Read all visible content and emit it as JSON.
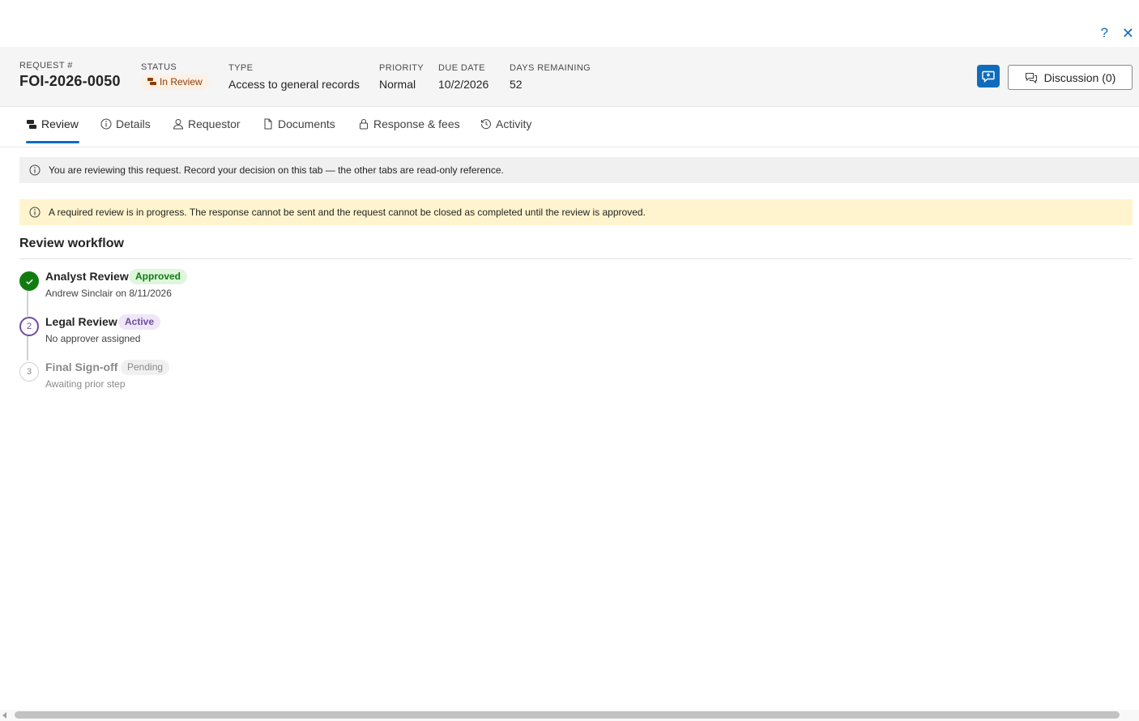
{
  "window_controls": {
    "help_label": "?",
    "close_label": "✕"
  },
  "header": {
    "request": {
      "label": "REQUEST #",
      "value": "FOI-2026-0050"
    },
    "status": {
      "label": "STATUS",
      "value": "In Review"
    },
    "type": {
      "label": "TYPE",
      "value": "Access to general records"
    },
    "priority": {
      "label": "PRIORITY",
      "value": "Normal"
    },
    "due_date": {
      "label": "DUE DATE",
      "value": "10/2/2026"
    },
    "days_remaining": {
      "label": "DAYS REMAINING",
      "value": "52"
    },
    "discussion_label": "Discussion (0)"
  },
  "tabs": [
    {
      "label": "Review",
      "icon": "review-icon",
      "active": true
    },
    {
      "label": "Details",
      "icon": "info-icon",
      "active": false
    },
    {
      "label": "Requestor",
      "icon": "person-icon",
      "active": false
    },
    {
      "label": "Documents",
      "icon": "document-icon",
      "active": false
    },
    {
      "label": "Response & fees",
      "icon": "lock-icon",
      "active": false
    },
    {
      "label": "Activity",
      "icon": "history-icon",
      "active": false
    }
  ],
  "banners": {
    "info": "You are reviewing this request. Record your decision on this tab — the other tabs are read-only reference.",
    "warning": "A required review is in progress. The response cannot be sent and the request cannot be closed as completed until the review is approved."
  },
  "workflow": {
    "title": "Review workflow",
    "steps": [
      {
        "number": "",
        "name": "Analyst Review",
        "status": "Approved",
        "detail": "Andrew Sinclair on 8/11/2026"
      },
      {
        "number": "2",
        "name": "Legal Review",
        "status": "Active",
        "detail": "No approver assigned"
      },
      {
        "number": "3",
        "name": "Final Sign-off",
        "status": "Pending",
        "detail": "Awaiting prior step"
      }
    ]
  },
  "colors": {
    "accent": "#0f6cbd",
    "approved_bg": "#dff6dd",
    "approved_fg": "#107c10",
    "active_bg": "#efe6f8",
    "active_fg": "#6f4c9b",
    "pending_bg": "#f0f0f0",
    "pending_fg": "#8a8a8a",
    "warning_bg": "#fff4ce",
    "status_bg": "#fdf0e4"
  }
}
